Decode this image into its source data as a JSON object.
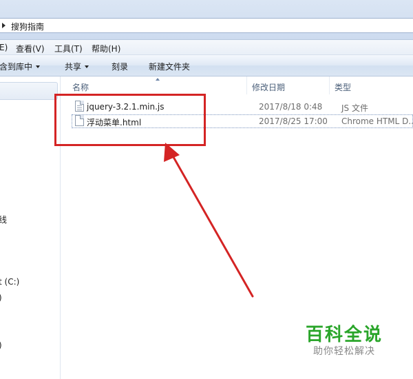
{
  "address": {
    "path": "搜狗指南"
  },
  "menu": [
    {
      "label": "E)"
    },
    {
      "label": "查看(V)"
    },
    {
      "label": "工具(T)"
    },
    {
      "label": "帮助(H)"
    }
  ],
  "commands": {
    "include_library": "含到库中",
    "share": "共享",
    "burn": "刻录",
    "new_folder": "新建文件夹"
  },
  "nav": [
    {
      "label": "线"
    },
    {
      "label": "t (C:)"
    },
    {
      "label": ")"
    },
    {
      "label": ")"
    }
  ],
  "columns": {
    "name": "名称",
    "modified": "修改日期",
    "type": "类型"
  },
  "files": [
    {
      "name": "jquery-3.2.1.min.js",
      "modified": "2017/8/18 0:48",
      "type": "JS 文件",
      "icon": "js-file-icon"
    },
    {
      "name": "浮动菜单.html",
      "modified": "2017/8/25 17:00",
      "type": "Chrome HTML D...",
      "icon": "html-file-icon"
    }
  ],
  "watermark": {
    "title": "百科全说",
    "subtitle": "助你轻松解决"
  },
  "colors": {
    "annotation": "#d42424",
    "watermark": "#2aa52a"
  }
}
